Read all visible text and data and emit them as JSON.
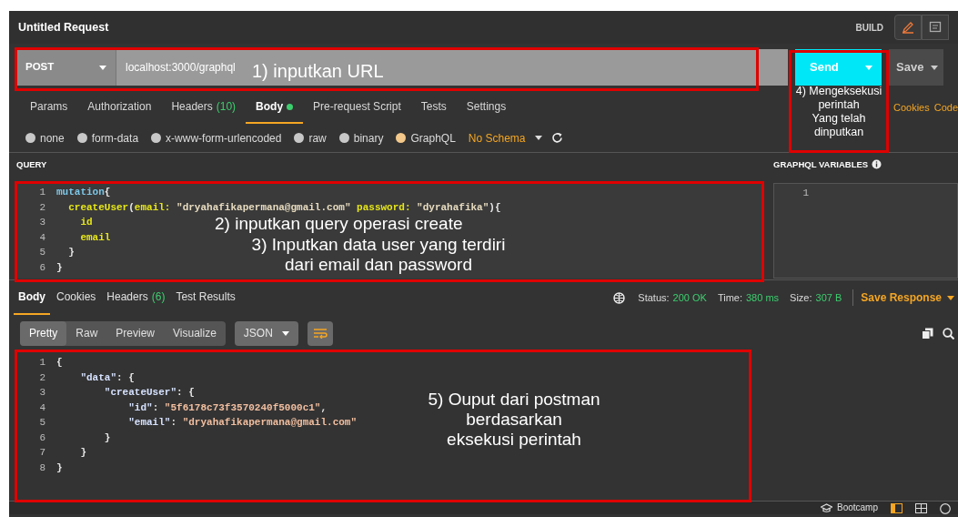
{
  "title": "Untitled Request",
  "mode": "BUILD",
  "request": {
    "method": "POST",
    "url": "localhost:3000/graphql",
    "send": "Send",
    "save": "Save"
  },
  "request_tabs": [
    {
      "label": "Params",
      "selected": false
    },
    {
      "label": "Authorization",
      "selected": false
    },
    {
      "label": "Headers",
      "count": "(10)",
      "selected": false
    },
    {
      "label": "Body",
      "selected": true,
      "dot": true
    },
    {
      "label": "Pre-request Script",
      "selected": false
    },
    {
      "label": "Tests",
      "selected": false
    },
    {
      "label": "Settings",
      "selected": false
    }
  ],
  "links": [
    "Cookies",
    "Code"
  ],
  "body_types": [
    {
      "label": "none",
      "selected": false
    },
    {
      "label": "form-data",
      "selected": false
    },
    {
      "label": "x-www-form-urlencoded",
      "selected": false
    },
    {
      "label": "raw",
      "selected": false
    },
    {
      "label": "binary",
      "selected": false
    },
    {
      "label": "GraphQL",
      "selected": true
    }
  ],
  "schema": "No Schema",
  "query": {
    "title": "QUERY",
    "lines": [
      {
        "n": "1",
        "tokens": [
          {
            "t": "mutation",
            "kind": "keyword"
          },
          {
            "t": "{",
            "kind": "punct"
          }
        ]
      },
      {
        "n": "2",
        "tokens": [
          {
            "t": "  createUser",
            "kind": "field"
          },
          {
            "t": "(",
            "kind": "punct"
          },
          {
            "t": "email: ",
            "kind": "field"
          },
          {
            "t": "\"dryahafikapermana@gmail.com\" ",
            "kind": "string"
          },
          {
            "t": "password: ",
            "kind": "field"
          },
          {
            "t": "\"dyrahafika\"",
            "kind": "string"
          },
          {
            "t": "){",
            "kind": "punct"
          }
        ]
      },
      {
        "n": "3",
        "tokens": [
          {
            "t": "    id",
            "kind": "field"
          }
        ]
      },
      {
        "n": "4",
        "tokens": [
          {
            "t": "    email",
            "kind": "field"
          }
        ]
      },
      {
        "n": "5",
        "tokens": [
          {
            "t": "  }",
            "kind": "punct"
          }
        ]
      },
      {
        "n": "6",
        "tokens": [
          {
            "t": "}",
            "kind": "punct"
          }
        ]
      }
    ]
  },
  "variables": {
    "title": "GRAPHQL VARIABLES",
    "lines": [
      "1"
    ]
  },
  "response_tabs": [
    {
      "label": "Body",
      "selected": true
    },
    {
      "label": "Cookies",
      "selected": false
    },
    {
      "label": "Headers",
      "count": "(6)",
      "selected": false
    },
    {
      "label": "Test Results",
      "selected": false
    }
  ],
  "status": [
    {
      "label": "Status:",
      "value": "200 OK"
    },
    {
      "label": "Time:",
      "value": "380 ms"
    },
    {
      "label": "Size:",
      "value": "307 B"
    }
  ],
  "save_response": "Save Response",
  "view_modes": [
    {
      "label": "Pretty",
      "selected": true
    },
    {
      "label": "Raw",
      "selected": false
    },
    {
      "label": "Preview",
      "selected": false
    },
    {
      "label": "Visualize",
      "selected": false
    }
  ],
  "format": "JSON",
  "response": {
    "lines": [
      {
        "n": "1",
        "tokens": [
          {
            "t": "{",
            "kind": "punct"
          }
        ]
      },
      {
        "n": "2",
        "tokens": [
          {
            "t": "    \"data\"",
            "kind": "key"
          },
          {
            "t": ": {",
            "kind": "punct"
          }
        ]
      },
      {
        "n": "3",
        "tokens": [
          {
            "t": "        \"createUser\"",
            "kind": "key"
          },
          {
            "t": ": {",
            "kind": "punct"
          }
        ]
      },
      {
        "n": "4",
        "tokens": [
          {
            "t": "            \"id\"",
            "kind": "key"
          },
          {
            "t": ": ",
            "kind": "punct"
          },
          {
            "t": "\"5f6178c73f3570240f5000c1\"",
            "kind": "value"
          },
          {
            "t": ",",
            "kind": "punct"
          }
        ]
      },
      {
        "n": "5",
        "tokens": [
          {
            "t": "            \"email\"",
            "kind": "key"
          },
          {
            "t": ": ",
            "kind": "punct"
          },
          {
            "t": "\"dryahafikapermana@gmail.com\"",
            "kind": "value"
          }
        ]
      },
      {
        "n": "6",
        "tokens": [
          {
            "t": "        }",
            "kind": "punct"
          }
        ]
      },
      {
        "n": "7",
        "tokens": [
          {
            "t": "    }",
            "kind": "punct"
          }
        ]
      },
      {
        "n": "8",
        "tokens": [
          {
            "t": "}",
            "kind": "punct"
          }
        ]
      }
    ]
  },
  "footer": {
    "label": "Bootcamp"
  },
  "annotations": [
    {
      "text": "1) inputkan URL"
    },
    {
      "text": "4) Mengeksekusi\nperintah\nYang telah\ndinputkan"
    },
    {
      "text": "2) inputkan query operasi create"
    },
    {
      "text": "3) Inputkan data user yang terdiri\ndari email dan password"
    },
    {
      "text": "5) Ouput dari postman\nberdasarkan\neksekusi perintah"
    }
  ]
}
